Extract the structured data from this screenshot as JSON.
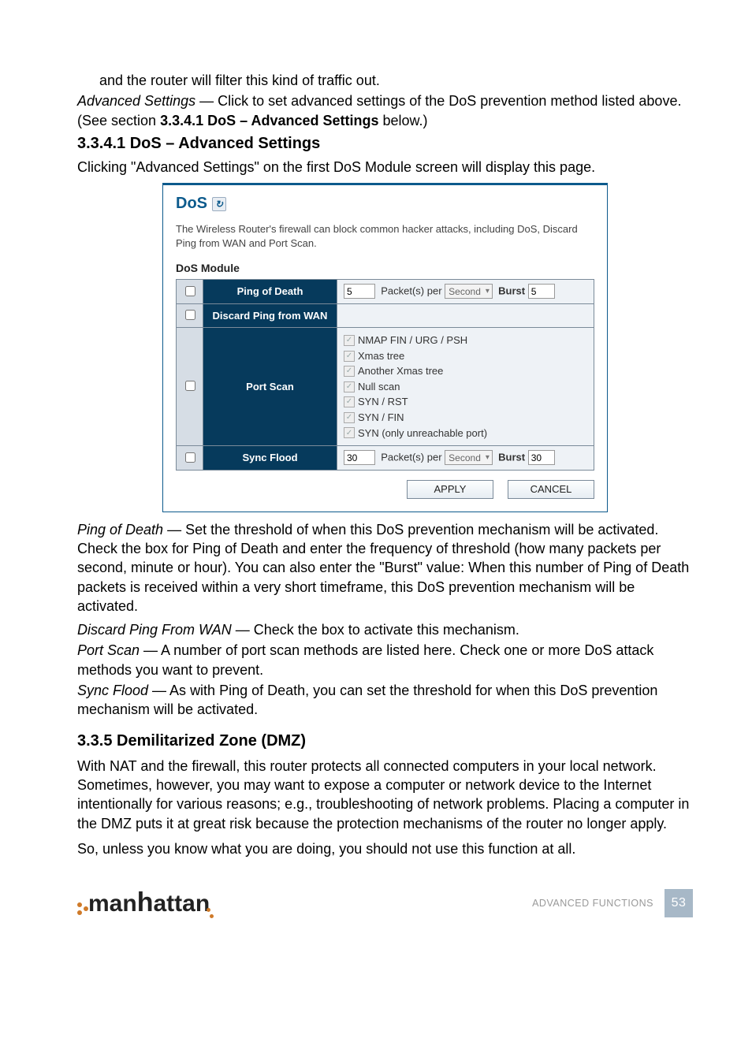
{
  "intro": {
    "line1": "and the router will filter this kind of traffic out.",
    "adv_label": "Advanced Settings",
    "adv_rest": " — Click to set advanced settings of the DoS prevention method listed above. (See section ",
    "adv_bold": "3.3.4.1 DoS – Advanced Settings",
    "adv_tail": " below.)"
  },
  "heading1": "3.3.4.1  DoS – Advanced Settings",
  "heading1_after": "Clicking \"Advanced Settings\" on the first DoS Module screen will display this page.",
  "dos": {
    "title": "DoS",
    "desc": "The Wireless Router's firewall can block common hacker attacks, including DoS, Discard Ping from WAN and Port Scan.",
    "module_label": "DoS Module",
    "rows": {
      "pod": {
        "name": "Ping of Death",
        "value": "5",
        "mid": "Packet(s) per",
        "unit": "Second",
        "burst_label": "Burst",
        "burst_value": "5"
      },
      "discard": {
        "name": "Discard Ping from WAN"
      },
      "portscan": {
        "name": "Port Scan",
        "opts": [
          "NMAP FIN / URG / PSH",
          "Xmas tree",
          "Another Xmas tree",
          "Null scan",
          "SYN / RST",
          "SYN / FIN",
          "SYN (only unreachable port)"
        ]
      },
      "sync": {
        "name": "Sync Flood",
        "value": "30",
        "mid": "Packet(s) per",
        "unit": "Second",
        "burst_label": "Burst",
        "burst_value": "30"
      }
    },
    "buttons": {
      "apply": "APPLY",
      "cancel": "CANCEL"
    }
  },
  "defs": {
    "pod_label": "Ping of Death",
    "pod_text": " — Set the threshold of when this DoS prevention mechanism will be activated. Check the box for Ping of Death and enter the frequency of threshold (how many packets per second, minute or hour). You can also enter the \"Burst\" value: When this number of Ping of Death packets is received within a very short timeframe, this DoS prevention mechanism will be activated.",
    "discard_label": "Discard Ping From WAN",
    "discard_text": " — Check the box to activate this mechanism.",
    "portscan_label": "Port Scan",
    "portscan_text": " — A number of port scan methods are listed here. Check one or more DoS attack methods you want to prevent.",
    "sync_label": "Sync Flood",
    "sync_text": " — As with Ping of Death, you can set the threshold for when this DoS prevention mechanism will be activated."
  },
  "heading2": "3.3.5  Demilitarized Zone (DMZ)",
  "dmz": {
    "p1": "With NAT and the firewall, this router protects all connected computers in your local network. Sometimes, however, you may want to expose a computer or network device to the Internet intentionally for various reasons; e.g., troubleshooting of network problems. Placing a computer in the DMZ puts it at great risk because the protection mechanisms of the router no longer apply.",
    "p2": "So, unless you know what you are doing, you should not use this function at all."
  },
  "footer": {
    "brand": "manhattan",
    "section": "ADVANCED FUNCTIONS",
    "page": "53"
  }
}
